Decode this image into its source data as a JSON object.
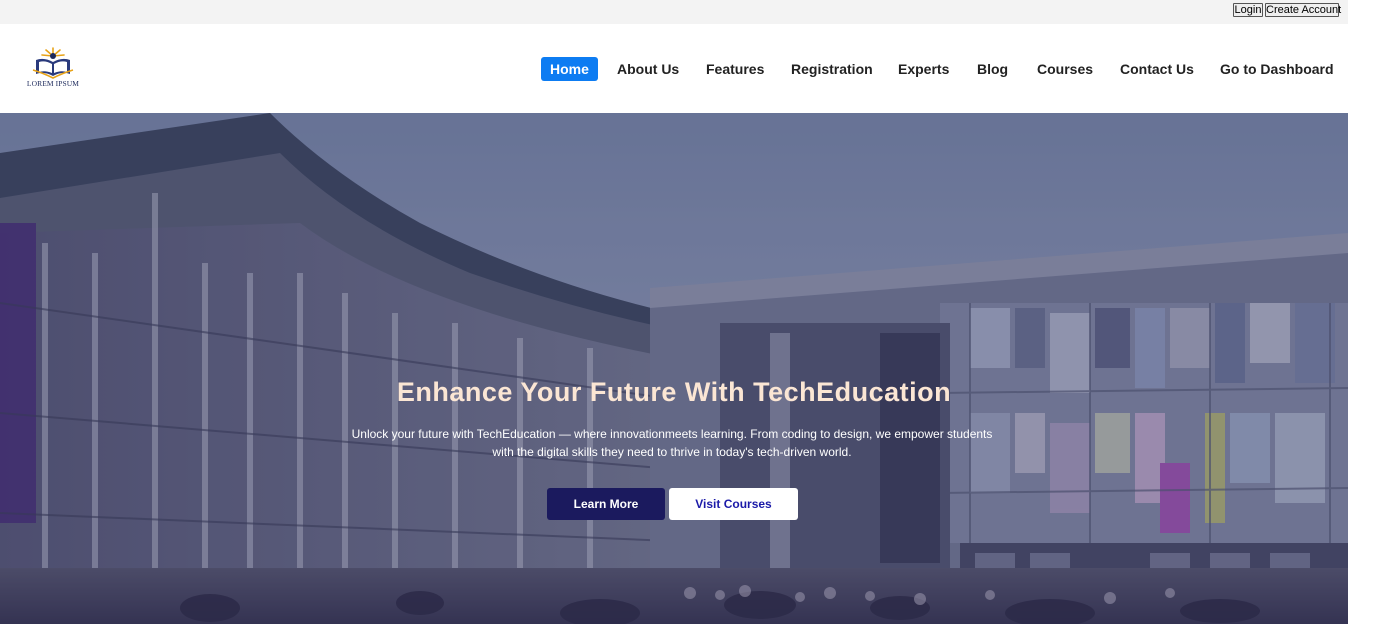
{
  "top_bar": {
    "login_label": "Login",
    "create_account_label": "Create Account"
  },
  "brand": {
    "logo_text": "LOREM IPSUM"
  },
  "nav": {
    "items": [
      {
        "label": "Home",
        "active": true
      },
      {
        "label": "About Us"
      },
      {
        "label": "Features"
      },
      {
        "label": "Registration"
      },
      {
        "label": "Experts"
      },
      {
        "label": "Blog"
      },
      {
        "label": "Courses"
      },
      {
        "label": "Contact Us"
      },
      {
        "label": "Go to Dashboard"
      }
    ]
  },
  "hero": {
    "title": "Enhance Your Future With TechEducation",
    "subtitle": "Unlock your future with TechEducation — where innovationmeets learning. From coding to design, we empower students with the digital skills they need to thrive in today's tech-driven world.",
    "learn_more_label": "Learn More",
    "visit_courses_label": "Visit Courses"
  },
  "colors": {
    "nav_active": "#0d7cf2",
    "hero_title": "#fbe6d4",
    "learn_more_bg": "#1b1a5e",
    "visit_courses_text": "#1b1aa8"
  }
}
